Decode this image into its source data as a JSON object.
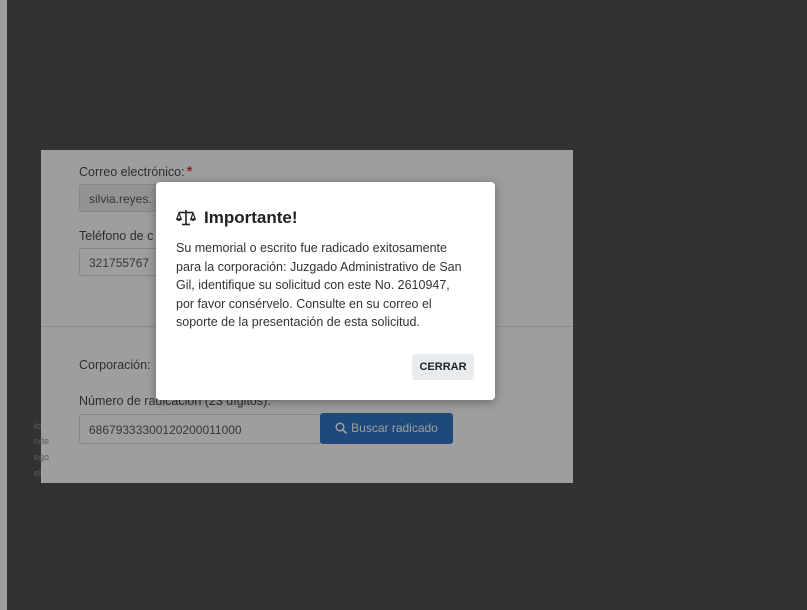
{
  "form": {
    "email_label": "Correo electrónico:",
    "email_value": "silvia.reyes.",
    "phone_label": "Teléfono de c",
    "phone_value": "321755767",
    "corporation_label": "Corporación:",
    "radicacion_label": "Número de radicación (23 dígitos):",
    "radicacion_value": "68679333300120200011000",
    "search_button_label": "Buscar radicado",
    "side_lines": [
      "lo",
      "nde",
      "ego",
      "el"
    ],
    "required_mark": "*"
  },
  "modal": {
    "title": "Importante!",
    "line1": "Su memorial o escrito fue radicado exitosamente",
    "line2": "para la corporación: Juzgado Administrativo de San",
    "line3": "Gil, identifique su solicitud con este No. 2610947,",
    "line4": "por favor consérvelo. Consulte en su correo el",
    "line5": "soporte de la presentación de esta solicitud.",
    "close_label": "CERRAR"
  },
  "colors": {
    "accent": "#1565c0",
    "required": "#d32f2f",
    "backdrop": "#3b3b3b"
  }
}
